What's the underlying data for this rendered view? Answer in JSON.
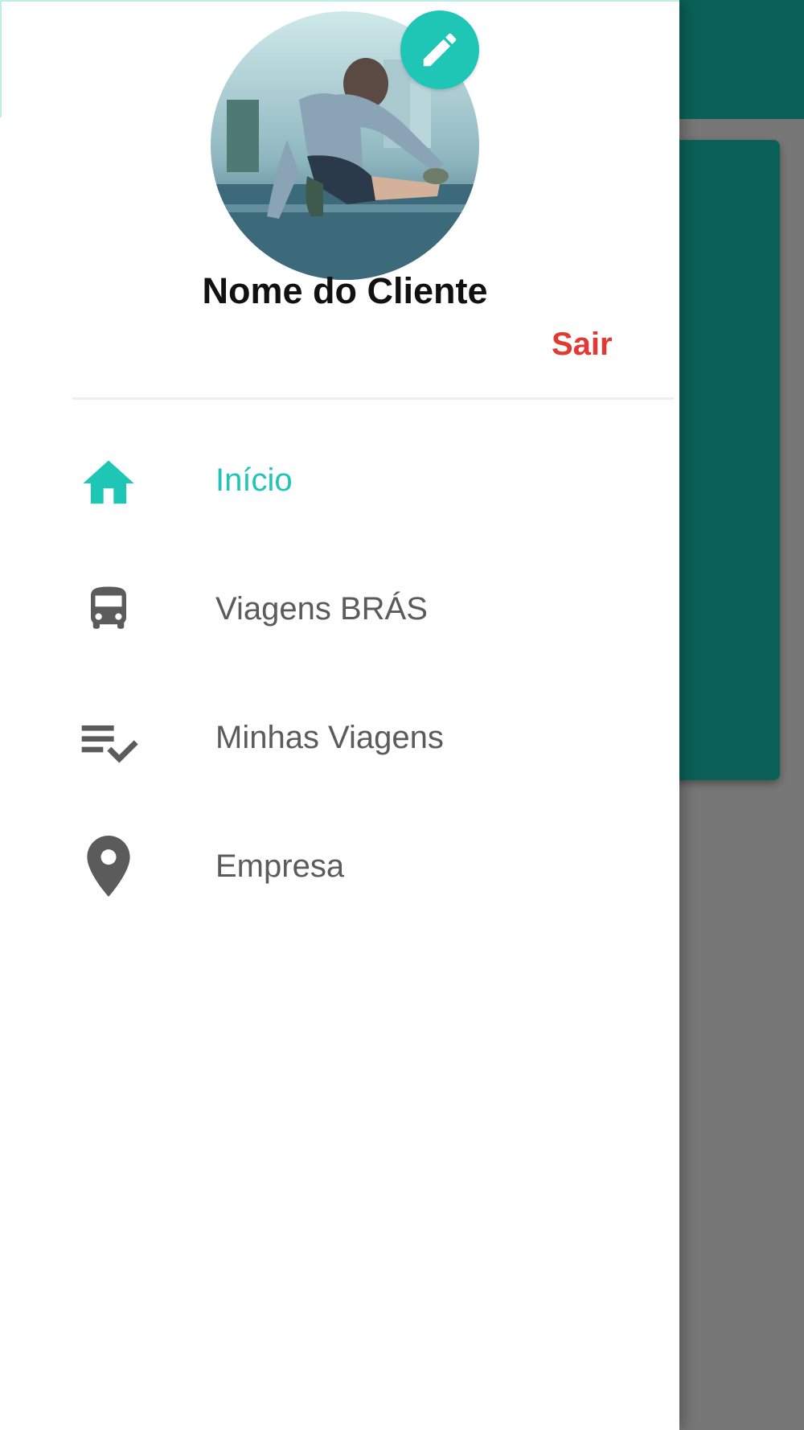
{
  "colors": {
    "accent": "#1fc6b5",
    "logout": "#e03a33",
    "icon_gray": "#5b5b5b",
    "background_teal": "#0b6157",
    "scrim": "#777777"
  },
  "profile": {
    "name": "Nome do Cliente",
    "logout_label": "Sair",
    "avatar_icon": "profile-photo",
    "edit_icon": "pencil-icon"
  },
  "menu": {
    "items": [
      {
        "label": "Início",
        "icon": "home-icon",
        "active": true
      },
      {
        "label": "Viagens BRÁS",
        "icon": "bus-icon",
        "active": false
      },
      {
        "label": "Minhas Viagens",
        "icon": "playlist-check-icon",
        "active": false
      },
      {
        "label": "Empresa",
        "icon": "location-pin-icon",
        "active": false
      }
    ]
  }
}
